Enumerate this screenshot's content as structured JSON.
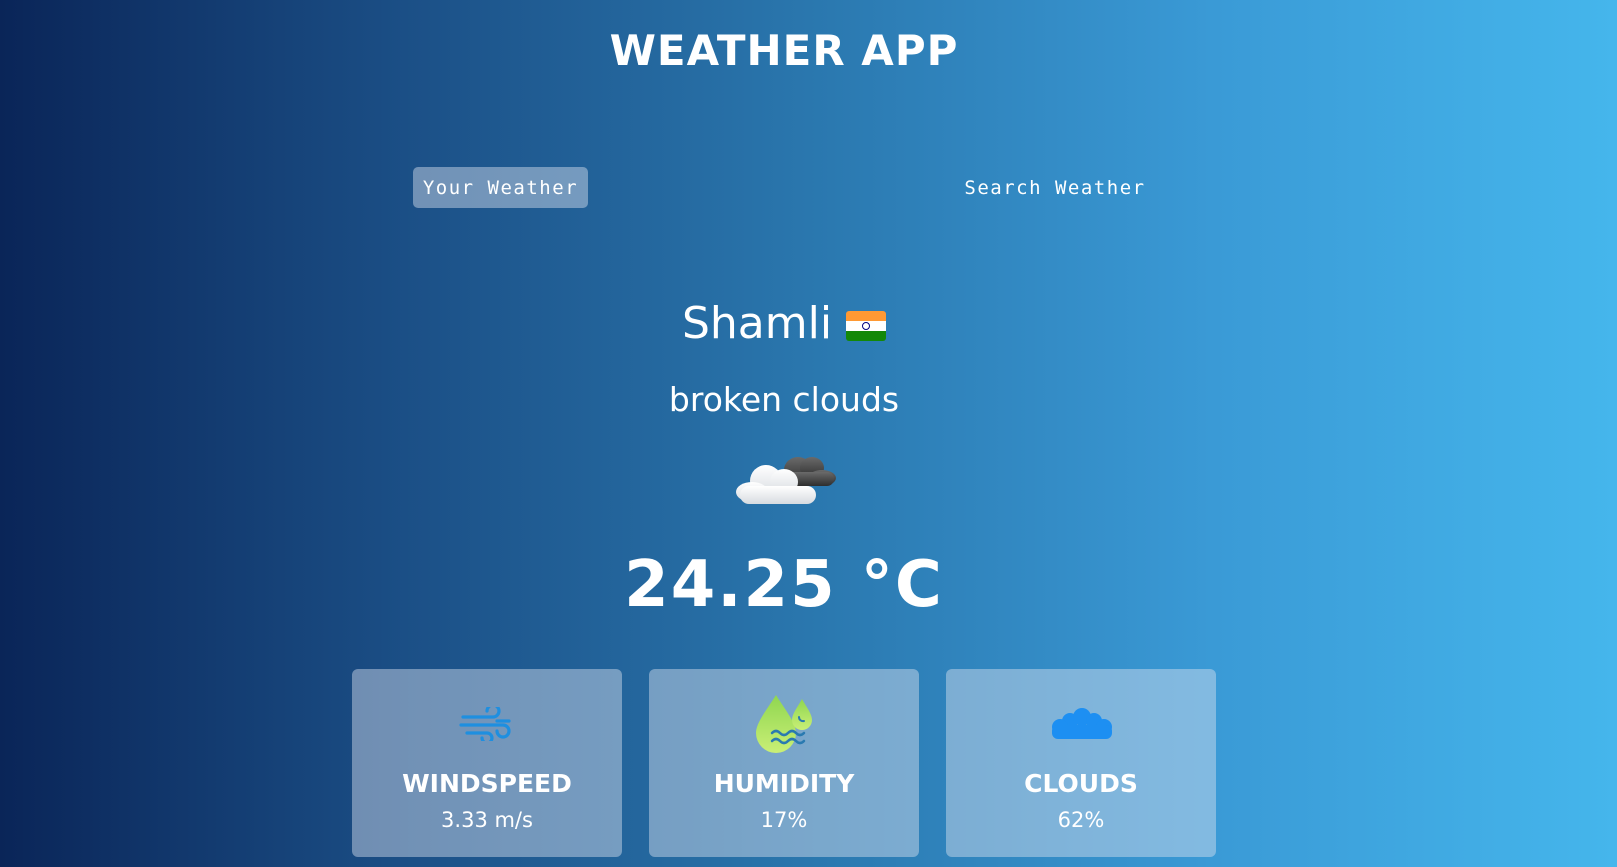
{
  "app": {
    "title": "WEATHER APP"
  },
  "tabs": [
    {
      "label": "Your Weather",
      "active": true
    },
    {
      "label": "Search Weather",
      "active": false
    }
  ],
  "location": {
    "city": "Shamli",
    "flag_icon": "india-flag-icon"
  },
  "weather": {
    "description": "broken clouds",
    "icon": "broken-clouds-icon",
    "temperature": "24.25 °C"
  },
  "stats": [
    {
      "label": "WINDSPEED",
      "value": "3.33 m/s",
      "icon": "wind-icon"
    },
    {
      "label": "HUMIDITY",
      "value": "17%",
      "icon": "humidity-icon"
    },
    {
      "label": "CLOUDS",
      "value": "62%",
      "icon": "clouds-icon"
    }
  ],
  "colors": {
    "gradient_start": "#0a2558",
    "gradient_end": "#45b6ec",
    "wind_icon": "#1e8fe0",
    "humidity_icon": "#a3e05a",
    "clouds_icon": "#1d8ff2"
  }
}
